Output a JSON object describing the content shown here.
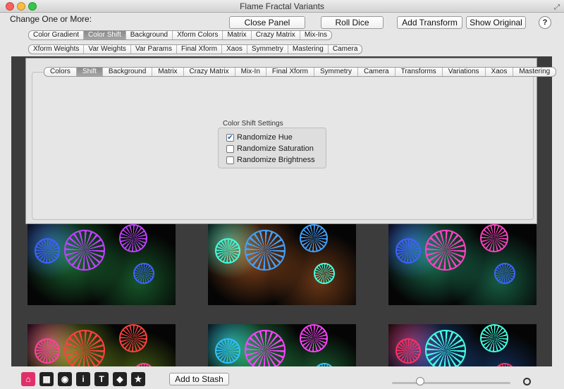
{
  "window": {
    "title": "Flame Fractal Variants",
    "fullscreen_icon": "fullscreen-icon"
  },
  "header": {
    "change_label": "Change One or More:",
    "close_panel": "Close Panel",
    "roll_dice": "Roll Dice",
    "add_transform": "Add Transform",
    "show_original": "Show Original",
    "help": "?"
  },
  "change_row1": [
    "Color Gradient",
    "Color Shift",
    "Background",
    "Xform Colors",
    "Matrix",
    "Crazy Matrix",
    "Mix-Ins"
  ],
  "change_row1_selected": 1,
  "change_row2": [
    "Xform Weights",
    "Var Weights",
    "Var Params",
    "Final Xform",
    "Xaos",
    "Symmetry",
    "Mastering",
    "Camera"
  ],
  "panel": {
    "tabs": [
      "Colors",
      "Shift",
      "Background",
      "Matrix",
      "Crazy Matrix",
      "Mix-In",
      "Final Xform",
      "Symmetry",
      "Camera",
      "Transforms",
      "Variations",
      "Xaos",
      "Mastering"
    ],
    "selected_tab": 1,
    "group_label": "Color Shift Settings",
    "options": [
      {
        "label": "Randomize Hue",
        "checked": true
      },
      {
        "label": "Randomize Saturation",
        "checked": false
      },
      {
        "label": "Randomize Brightness",
        "checked": false
      }
    ]
  },
  "thumbnails": [
    {
      "accent": "#c040ff",
      "alt": "#30d060",
      "glow": "#4060ff"
    },
    {
      "accent": "#40a0ff",
      "alt": "#ff8030",
      "glow": "#40ffe0"
    },
    {
      "accent": "#ff40c0",
      "alt": "#30e0a0",
      "glow": "#4060ff"
    },
    {
      "accent": "#ff4040",
      "alt": "#c0ff30",
      "glow": "#ff40a0"
    },
    {
      "accent": "#ff40ff",
      "alt": "#40ff80",
      "glow": "#30c0ff"
    },
    {
      "accent": "#40ffe0",
      "alt": "#3080ff",
      "glow": "#ff3060"
    }
  ],
  "bottom": {
    "add_to_stash": "Add to Stash",
    "tools": [
      {
        "icon": "home-icon",
        "glyph": "⌂",
        "color": "#e0306a"
      },
      {
        "icon": "grid-icon",
        "glyph": "▦",
        "color": "#222"
      },
      {
        "icon": "eye-icon",
        "glyph": "◉",
        "color": "#222"
      },
      {
        "icon": "info-icon",
        "glyph": "i",
        "color": "#222"
      },
      {
        "icon": "text-icon",
        "glyph": "T",
        "color": "#222"
      },
      {
        "icon": "palette-icon",
        "glyph": "◆",
        "color": "#222"
      },
      {
        "icon": "star-icon",
        "glyph": "★",
        "color": "#222"
      }
    ],
    "slider_value": 0.24
  }
}
